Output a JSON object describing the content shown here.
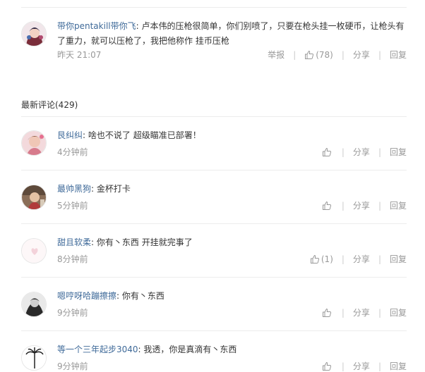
{
  "hot_comment": {
    "user": "带你pentakill带你飞",
    "text": "卢本伟的压枪很简单，你们别喷了，只要在枪头挂一枚硬币，让枪头有了重力，就可以压枪了，我把他称作 挂币压枪",
    "time": "昨天 21:07",
    "report": "举报",
    "likes": "(78)",
    "share": "分享",
    "reply": "回复"
  },
  "latest": {
    "title": "最新评论(429)"
  },
  "comments": [
    {
      "user": "艮纠纠",
      "text": "啥也不说了 超级瞄准已部署！",
      "time": "4分钟前",
      "likes": "",
      "share": "分享",
      "reply": "回复"
    },
    {
      "user": "最帅黑狗",
      "text": "金杯打卡",
      "time": "5分钟前",
      "likes": "",
      "share": "分享",
      "reply": "回复"
    },
    {
      "user": "甜且软柔",
      "text": "你有丶东西 开挂就完事了",
      "time": "8分钟前",
      "likes": "(1)",
      "share": "分享",
      "reply": "回复"
    },
    {
      "user": "嗯哼呀哈蹦擦擦",
      "text": "你有丶东西",
      "time": "9分钟前",
      "likes": "",
      "share": "分享",
      "reply": "回复"
    },
    {
      "user": "等一个三年起步3040",
      "text": "我透，你是真滴有丶东西",
      "time": "9分钟前",
      "likes": "",
      "share": "分享",
      "reply": "回复"
    }
  ],
  "colors": {
    "username": "#3f6a99",
    "meta": "#999999",
    "divider": "#ececec"
  }
}
